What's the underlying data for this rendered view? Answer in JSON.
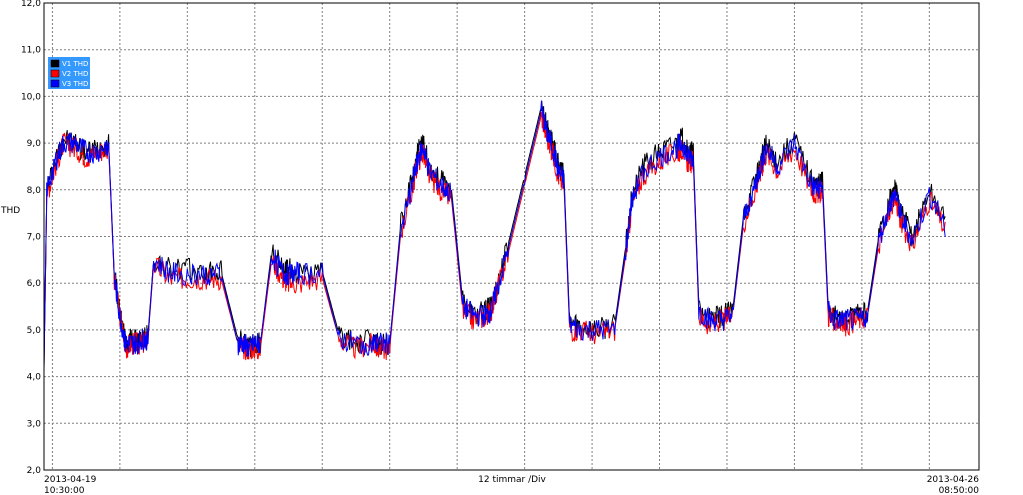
{
  "chart_data": {
    "type": "line",
    "ylabel": "THD",
    "ylim": [
      2.0,
      12.0
    ],
    "y_ticks": [
      "2,0",
      "3,0",
      "4,0",
      "5,0",
      "6,0",
      "7,0",
      "8,0",
      "9,0",
      "10,0",
      "11,0",
      "12,0"
    ],
    "x_start_label": [
      "2013-04-19",
      "10:30:00"
    ],
    "x_end_label": [
      "2013-04-26",
      "08:50:00"
    ],
    "x_center_label": "12 timmar /Div",
    "xlim": [
      "2013-04-19 10:30",
      "2013-04-26 08:50"
    ],
    "grid": true,
    "legend_position": "top-left",
    "legend_background": "#3399ff",
    "x": [
      "2013-04-19 10:30",
      "2013-04-19 11:00",
      "2013-04-19 12:30",
      "2013-04-19 14:00",
      "2013-04-19 16:00",
      "2013-04-19 18:00",
      "2013-04-19 20:00",
      "2013-04-19 22:00",
      "2013-04-19 23:00",
      "2013-04-20 00:00",
      "2013-04-20 01:00",
      "2013-04-20 02:00",
      "2013-04-20 03:00",
      "2013-04-20 04:00",
      "2013-04-20 05:00",
      "2013-04-20 06:00",
      "2013-04-20 09:00",
      "2013-04-20 12:00",
      "2013-04-20 15:00",
      "2013-04-20 18:00",
      "2013-04-20 21:00",
      "2013-04-20 22:00",
      "2013-04-20 23:00",
      "2013-04-21 00:00",
      "2013-04-21 01:00",
      "2013-04-21 03:00",
      "2013-04-21 05:00",
      "2013-04-21 06:00",
      "2013-04-21 08:00",
      "2013-04-21 12:00",
      "2013-04-21 15:00",
      "2013-04-21 18:00",
      "2013-04-21 21:00",
      "2013-04-21 22:00",
      "2013-04-22 00:00",
      "2013-04-22 02:00",
      "2013-04-22 04:00",
      "2013-04-22 05:00",
      "2013-04-22 06:00",
      "2013-04-22 07:00",
      "2013-04-22 09:00",
      "2013-04-22 11:00",
      "2013-04-22 13:00",
      "2013-04-22 15:00",
      "2013-04-22 17:00",
      "2013-04-22 18:00",
      "2013-04-22 19:00",
      "2013-04-22 21:00",
      "2013-04-23 00:00",
      "2013-04-23 03:00",
      "2013-04-23 04:00",
      "2013-04-23 05:00",
      "2013-04-23 06:00",
      "2013-04-23 07:00",
      "2013-04-23 08:00",
      "2013-04-23 10:00",
      "2013-04-23 13:00",
      "2013-04-23 16:00",
      "2013-04-23 18:00",
      "2013-04-23 19:00",
      "2013-04-23 21:00",
      "2013-04-24 00:00",
      "2013-04-24 03:00",
      "2013-04-24 04:00",
      "2013-04-24 05:00",
      "2013-04-24 06:00",
      "2013-04-24 07:00",
      "2013-04-24 09:00",
      "2013-04-24 11:00",
      "2013-04-24 13:00",
      "2013-04-24 15:00",
      "2013-04-24 17:00",
      "2013-04-24 18:00",
      "2013-04-24 19:00",
      "2013-04-24 21:00",
      "2013-04-25 00:00",
      "2013-04-25 03:00",
      "2013-04-25 04:00",
      "2013-04-25 05:00",
      "2013-04-25 06:00",
      "2013-04-25 07:00",
      "2013-04-25 09:00",
      "2013-04-25 11:00",
      "2013-04-25 13:00",
      "2013-04-25 15:00",
      "2013-04-25 17:00",
      "2013-04-25 18:00",
      "2013-04-25 19:00",
      "2013-04-25 21:00",
      "2013-04-26 00:00",
      "2013-04-26 03:00",
      "2013-04-26 04:00",
      "2013-04-26 05:00",
      "2013-04-26 06:00",
      "2013-04-26 07:00",
      "2013-04-26 08:00",
      "2013-04-26 08:50"
    ],
    "series": [
      {
        "name": "V1 THD",
        "color": "#000000",
        "values": [
          4.3,
          8.0,
          8.6,
          9.1,
          9.0,
          8.8,
          8.9,
          9.0,
          6.2,
          5.4,
          4.7,
          4.8,
          4.75,
          4.8,
          4.9,
          6.5,
          6.3,
          6.3,
          6.2,
          6.25,
          4.8,
          4.7,
          4.6,
          4.7,
          4.7,
          6.7,
          6.3,
          6.3,
          6.2,
          6.25,
          4.9,
          4.7,
          4.8,
          4.7,
          4.7,
          7.3,
          8.2,
          8.8,
          9.0,
          8.5,
          8.2,
          8.0,
          5.6,
          5.3,
          5.4,
          5.5,
          5.9,
          6.8,
          8.3,
          9.8,
          9.3,
          9.0,
          8.5,
          8.3,
          5.2,
          5.1,
          5.0,
          5.1,
          6.8,
          7.8,
          8.5,
          8.8,
          9.0,
          9.1,
          8.8,
          8.8,
          5.5,
          5.2,
          5.3,
          5.4,
          7.5,
          8.2,
          8.6,
          9.0,
          8.6,
          9.1,
          8.2,
          8.1,
          8.2,
          5.5,
          5.3,
          5.2,
          5.3,
          5.4,
          7.0,
          7.8,
          8.0,
          7.5,
          7.0,
          8.0,
          7.3
        ]
      },
      {
        "name": "V2 THD",
        "color": "#ff0000",
        "values": [
          4.3,
          7.9,
          8.5,
          9.0,
          8.9,
          8.7,
          8.8,
          8.9,
          6.1,
          5.3,
          4.6,
          4.7,
          4.7,
          4.7,
          4.8,
          6.4,
          6.1,
          6.1,
          6.1,
          6.1,
          4.7,
          4.6,
          4.6,
          4.6,
          4.6,
          6.5,
          6.1,
          6.0,
          6.0,
          6.1,
          4.8,
          4.6,
          4.7,
          4.6,
          4.6,
          7.1,
          8.0,
          8.6,
          8.8,
          8.3,
          8.0,
          7.8,
          5.4,
          5.2,
          5.3,
          5.4,
          5.8,
          6.6,
          8.1,
          9.6,
          9.1,
          8.8,
          8.3,
          8.1,
          5.0,
          5.0,
          4.9,
          5.0,
          6.6,
          7.6,
          8.3,
          8.6,
          8.8,
          8.9,
          8.6,
          8.6,
          5.3,
          5.1,
          5.2,
          5.3,
          7.3,
          8.0,
          8.4,
          8.8,
          8.4,
          8.9,
          8.0,
          7.9,
          8.0,
          5.3,
          5.2,
          5.1,
          5.2,
          5.3,
          6.8,
          7.6,
          7.8,
          7.3,
          6.8,
          7.8,
          7.1
        ]
      },
      {
        "name": "V3 THD",
        "color": "#0000ff",
        "values": [
          4.2,
          8.0,
          8.6,
          9.0,
          9.0,
          8.8,
          8.8,
          9.0,
          6.1,
          5.3,
          4.7,
          4.7,
          4.7,
          4.8,
          4.8,
          6.5,
          6.2,
          6.2,
          6.2,
          6.2,
          4.7,
          4.7,
          4.6,
          4.7,
          4.7,
          6.6,
          6.2,
          6.2,
          6.2,
          6.2,
          4.8,
          4.7,
          4.7,
          4.7,
          4.7,
          7.2,
          8.1,
          8.7,
          8.9,
          8.4,
          8.1,
          7.9,
          5.5,
          5.3,
          5.3,
          5.4,
          5.8,
          6.7,
          8.2,
          9.7,
          9.2,
          8.9,
          8.4,
          8.2,
          5.1,
          5.0,
          5.0,
          5.0,
          6.7,
          7.7,
          8.4,
          8.7,
          8.9,
          9.0,
          8.7,
          8.7,
          5.4,
          5.2,
          5.2,
          5.3,
          7.4,
          8.1,
          8.5,
          8.9,
          8.5,
          9.0,
          8.1,
          8.0,
          8.1,
          5.4,
          5.2,
          5.2,
          5.2,
          5.3,
          6.9,
          7.7,
          7.9,
          7.4,
          6.9,
          7.9,
          7.2
        ]
      }
    ]
  }
}
